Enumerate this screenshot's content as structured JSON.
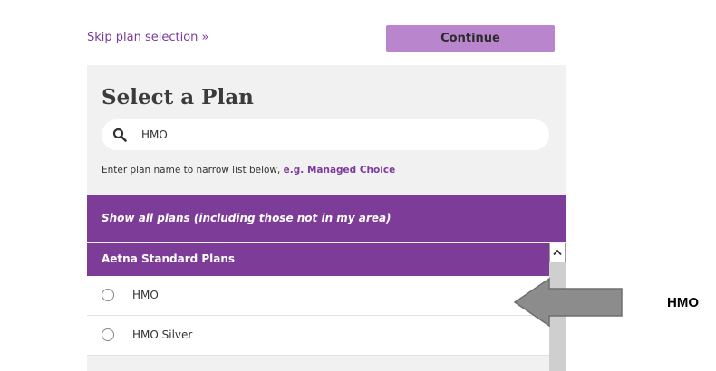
{
  "header": {
    "skip_label": "Skip plan selection »",
    "continue_label": "Continue"
  },
  "panel": {
    "title": "Select a Plan",
    "search": {
      "value": "HMO",
      "icon": "search-icon"
    },
    "hint_text": "Enter plan name to narrow list below, ",
    "hint_example": "e.g. Managed Choice",
    "show_all_label": "Show all plans (including those not in my area)",
    "group_header": "Aetna Standard Plans",
    "plans": [
      {
        "label": "HMO",
        "selected": false
      },
      {
        "label": "HMO Silver",
        "selected": false
      }
    ]
  },
  "annotation": {
    "label": "HMO",
    "arrow_color": "#8c8c8c"
  },
  "colors": {
    "brand_purple": "#7d3c98",
    "button_purple": "#b985cc",
    "panel_gray": "#f1f1f1"
  }
}
